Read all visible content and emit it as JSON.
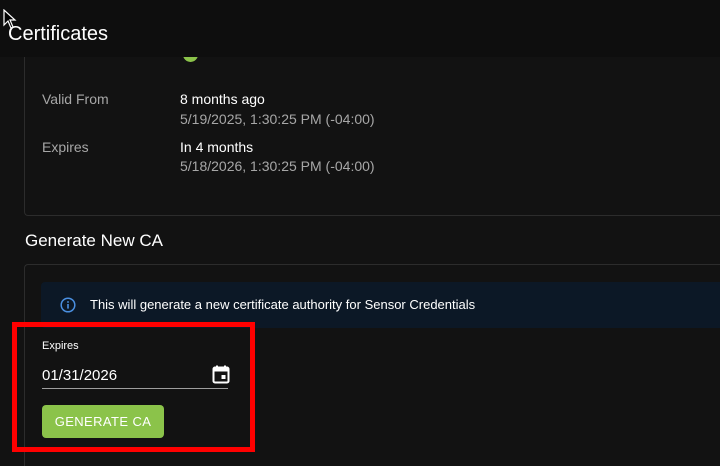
{
  "header": {
    "title": "Certificates"
  },
  "certificate": {
    "valid_from": {
      "label": "Valid From",
      "relative": "8 months ago",
      "absolute": "5/19/2025, 1:30:25 PM (-04:00)"
    },
    "expires": {
      "label": "Expires",
      "relative": "In 4 months",
      "absolute": "5/18/2026, 1:30:25 PM (-04:00)"
    }
  },
  "generate_ca": {
    "section_title": "Generate New CA",
    "info_message": "This will generate a new certificate authority for Sensor Credentials",
    "expires_label": "Expires",
    "expires_value": "01/31/2026",
    "button_label": "GENERATE CA"
  },
  "colors": {
    "accent_green": "#8bc34a",
    "info_blue": "#4a8fe0",
    "highlight_red": "#ff0000"
  },
  "icons": {
    "info": "info-circle-icon",
    "calendar": "calendar-icon",
    "status": "status-dot-icon",
    "cursor": "mouse-cursor-icon"
  }
}
